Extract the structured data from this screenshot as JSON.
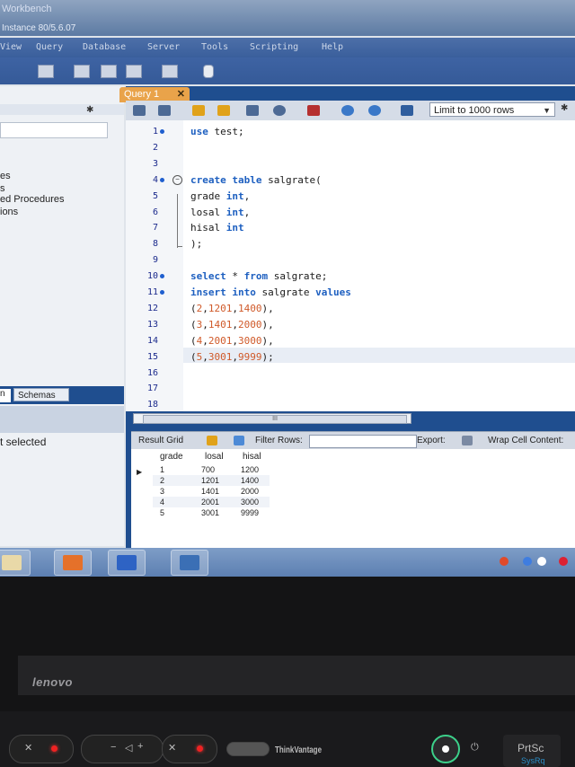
{
  "window": {
    "title": "Workbench",
    "subtitle": "Instance 80/5.6.07"
  },
  "menu": [
    "View",
    "Query",
    "Database",
    "Server",
    "Tools",
    "Scripting",
    "Help"
  ],
  "sidebar": {
    "items": [
      "es",
      "s",
      "ed Procedures",
      "ions"
    ],
    "tab_partial": "n",
    "tab_schemas": "Schemas",
    "object_info": "t selected"
  },
  "query_tab": {
    "label": "Query 1",
    "close": "✕"
  },
  "editor_toolbar": {
    "limit": "Limit to 1000 rows"
  },
  "editor": {
    "lines": [
      {
        "n": "1",
        "dot": true,
        "code": [
          {
            "t": "use ",
            "c": "kw"
          },
          {
            "t": "test;",
            "c": ""
          }
        ]
      },
      {
        "n": "2",
        "dot": false,
        "code": []
      },
      {
        "n": "3",
        "dot": false,
        "code": []
      },
      {
        "n": "4",
        "dot": true,
        "code": [
          {
            "t": "create table ",
            "c": "kw"
          },
          {
            "t": "salgrate(",
            "c": ""
          }
        ]
      },
      {
        "n": "5",
        "dot": false,
        "code": [
          {
            "t": "grade ",
            "c": ""
          },
          {
            "t": "int",
            "c": "kw"
          },
          {
            "t": ",",
            "c": ""
          }
        ]
      },
      {
        "n": "6",
        "dot": false,
        "code": [
          {
            "t": "losal ",
            "c": ""
          },
          {
            "t": "int",
            "c": "kw"
          },
          {
            "t": ",",
            "c": ""
          }
        ]
      },
      {
        "n": "7",
        "dot": false,
        "code": [
          {
            "t": "hisal ",
            "c": ""
          },
          {
            "t": "int",
            "c": "kw"
          }
        ]
      },
      {
        "n": "8",
        "dot": false,
        "code": [
          {
            "t": ");",
            "c": ""
          }
        ]
      },
      {
        "n": "9",
        "dot": false,
        "code": []
      },
      {
        "n": "10",
        "dot": true,
        "code": [
          {
            "t": "select ",
            "c": "kw"
          },
          {
            "t": "* ",
            "c": ""
          },
          {
            "t": "from ",
            "c": "kw"
          },
          {
            "t": "salgrate;",
            "c": ""
          }
        ]
      },
      {
        "n": "11",
        "dot": true,
        "code": [
          {
            "t": "insert into ",
            "c": "kw"
          },
          {
            "t": "salgrate ",
            "c": ""
          },
          {
            "t": "values",
            "c": "kw"
          }
        ]
      },
      {
        "n": "12",
        "dot": false,
        "code": [
          {
            "t": "(",
            "c": ""
          },
          {
            "t": "2",
            "c": "nm"
          },
          {
            "t": ",",
            "c": ""
          },
          {
            "t": "1201",
            "c": "nm"
          },
          {
            "t": ",",
            "c": ""
          },
          {
            "t": "1400",
            "c": "nm"
          },
          {
            "t": "),",
            "c": ""
          }
        ]
      },
      {
        "n": "13",
        "dot": false,
        "code": [
          {
            "t": "(",
            "c": ""
          },
          {
            "t": "3",
            "c": "nm"
          },
          {
            "t": ",",
            "c": ""
          },
          {
            "t": "1401",
            "c": "nm"
          },
          {
            "t": ",",
            "c": ""
          },
          {
            "t": "2000",
            "c": "nm"
          },
          {
            "t": "),",
            "c": ""
          }
        ]
      },
      {
        "n": "14",
        "dot": false,
        "code": [
          {
            "t": "(",
            "c": ""
          },
          {
            "t": "4",
            "c": "nm"
          },
          {
            "t": ",",
            "c": ""
          },
          {
            "t": "2001",
            "c": "nm"
          },
          {
            "t": ",",
            "c": ""
          },
          {
            "t": "3000",
            "c": "nm"
          },
          {
            "t": "),",
            "c": ""
          }
        ]
      },
      {
        "n": "15",
        "dot": false,
        "code": [
          {
            "t": "(",
            "c": ""
          },
          {
            "t": "5",
            "c": "nm"
          },
          {
            "t": ",",
            "c": ""
          },
          {
            "t": "3001",
            "c": "nm"
          },
          {
            "t": ",",
            "c": ""
          },
          {
            "t": "9999",
            "c": "nm"
          },
          {
            "t": ");",
            "c": ""
          }
        ]
      },
      {
        "n": "16",
        "dot": false,
        "code": []
      },
      {
        "n": "17",
        "dot": false,
        "code": []
      },
      {
        "n": "18",
        "dot": false,
        "code": []
      }
    ]
  },
  "scrollbar_grip": "III",
  "result_toolbar": {
    "result_grid": "Result Grid",
    "filter_rows": "Filter Rows:",
    "export": "Export:",
    "wrap": "Wrap Cell Content:"
  },
  "result_grid": {
    "columns": [
      "grade",
      "losal",
      "hisal"
    ],
    "rows": [
      [
        "1",
        "700",
        "1200"
      ],
      [
        "2",
        "1201",
        "1400"
      ],
      [
        "3",
        "1401",
        "2000"
      ],
      [
        "4",
        "2001",
        "3000"
      ],
      [
        "5",
        "3001",
        "9999"
      ]
    ]
  },
  "laptop": {
    "brand": "lenovo",
    "thinkvantage": "ThinkVantage",
    "prtsc": "PrtSc",
    "sysrq": "SysRq"
  },
  "colors": {
    "keyword": "#1d5fc0",
    "number": "#d05a2a",
    "tab_accent": "#e9a34a",
    "panel_blue": "#1f4e8f"
  }
}
